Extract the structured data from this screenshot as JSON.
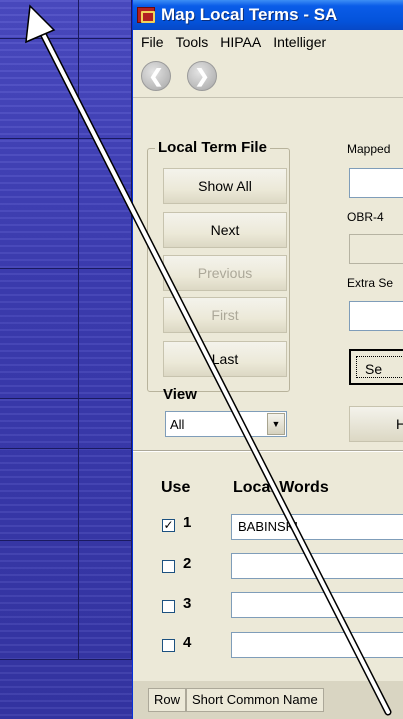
{
  "window": {
    "title": "Map Local Terms - SA",
    "accent_color": "#0453db"
  },
  "menu": [
    "File",
    "Tools",
    "HIPAA",
    "Intelliger"
  ],
  "toolbar": {
    "back_icon": "back-arrow-icon",
    "forward_icon": "forward-arrow-icon"
  },
  "local_term_file": {
    "legend": "Local Term File",
    "buttons": [
      {
        "label": "Show All",
        "enabled": true
      },
      {
        "label": "Next",
        "enabled": true
      },
      {
        "label": "Previous",
        "enabled": false
      },
      {
        "label": "First",
        "enabled": false
      },
      {
        "label": "Last",
        "enabled": true
      }
    ]
  },
  "view": {
    "label": "View",
    "value": "All"
  },
  "right_panel": {
    "mapped_label": "Mapped",
    "obr_label": "OBR-4",
    "extra_label": "Extra Se",
    "search_button_label": "Se",
    "h_button_label": "H"
  },
  "local_words": {
    "use_header": "Use",
    "words_header": "Local Words",
    "rows": [
      {
        "num": "1",
        "checked": true,
        "value": "BABINSKI"
      },
      {
        "num": "2",
        "checked": false,
        "value": ""
      },
      {
        "num": "3",
        "checked": false,
        "value": ""
      },
      {
        "num": "4",
        "checked": false,
        "value": ""
      }
    ]
  },
  "bottom_table": {
    "columns": [
      "Row",
      "Short Common Name"
    ]
  }
}
